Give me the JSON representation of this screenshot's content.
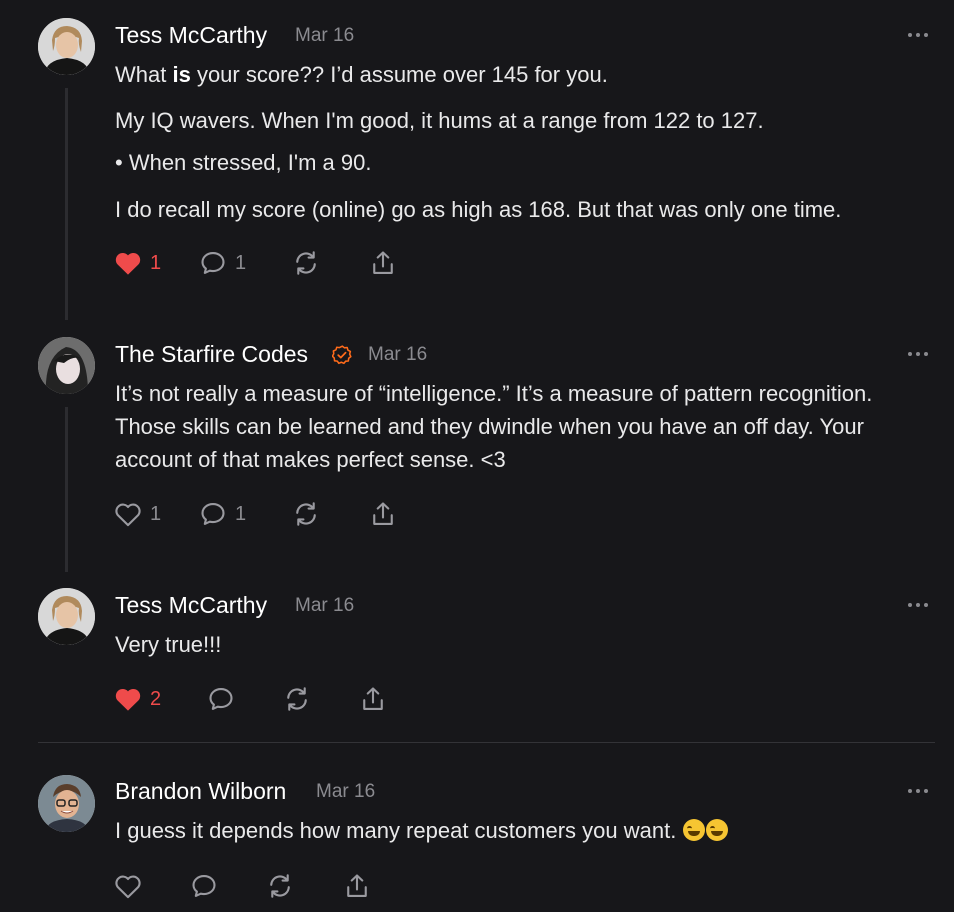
{
  "posts": [
    {
      "author": "Tess McCarthy",
      "date": "Mar 16",
      "avatar_icon": "avatar-photo-woman-short-hair",
      "paragraphs": [
        {
          "pre": "What ",
          "bold": "is",
          "post": " your score?? I’d assume over 145 for you."
        },
        {
          "text": "My IQ wavers. When I'm good, it hums at a range from 122 to 127."
        },
        {
          "text": "• When stressed, I'm a 90."
        },
        {
          "text": "I do recall my score (online) go as high as 168. But that was only one time."
        }
      ],
      "likes": "1",
      "liked": true,
      "comments": "1"
    },
    {
      "author": "The Starfire Codes",
      "date": "Mar 16",
      "verified": true,
      "avatar_icon": "avatar-photo-woman-dark-hair",
      "paragraphs": [
        {
          "text": "It’s not really a measure of “intelligence.” It’s a measure of pattern recognition. Those skills can be learned and they dwindle when you have an off day. Your account of that makes perfect sense. <3"
        }
      ],
      "likes": "1",
      "liked": false,
      "comments": "1"
    },
    {
      "author": "Tess McCarthy",
      "date": "Mar 16",
      "avatar_icon": "avatar-photo-woman-short-hair",
      "paragraphs": [
        {
          "text": "Very true!!!"
        }
      ],
      "likes": "2",
      "liked": true,
      "comments": ""
    },
    {
      "author": "Brandon Wilborn",
      "date": "Mar 16",
      "avatar_icon": "avatar-photo-man-glasses",
      "paragraphs": [
        {
          "text": "I guess it depends how many repeat customers you want. ",
          "emoji": [
            "grinning-sweat-emoji",
            "grinning-sweat-emoji"
          ]
        }
      ],
      "likes": "",
      "liked": false,
      "comments": ""
    }
  ],
  "colors": {
    "background": "#17171a",
    "text": "#ececec",
    "muted": "#8b8b90",
    "like": "#ef4b4b",
    "verified": "#ff6b1a"
  },
  "icons": [
    "heart-icon",
    "comment-icon",
    "restack-icon",
    "share-icon",
    "more-options-icon",
    "verified-badge-icon"
  ]
}
